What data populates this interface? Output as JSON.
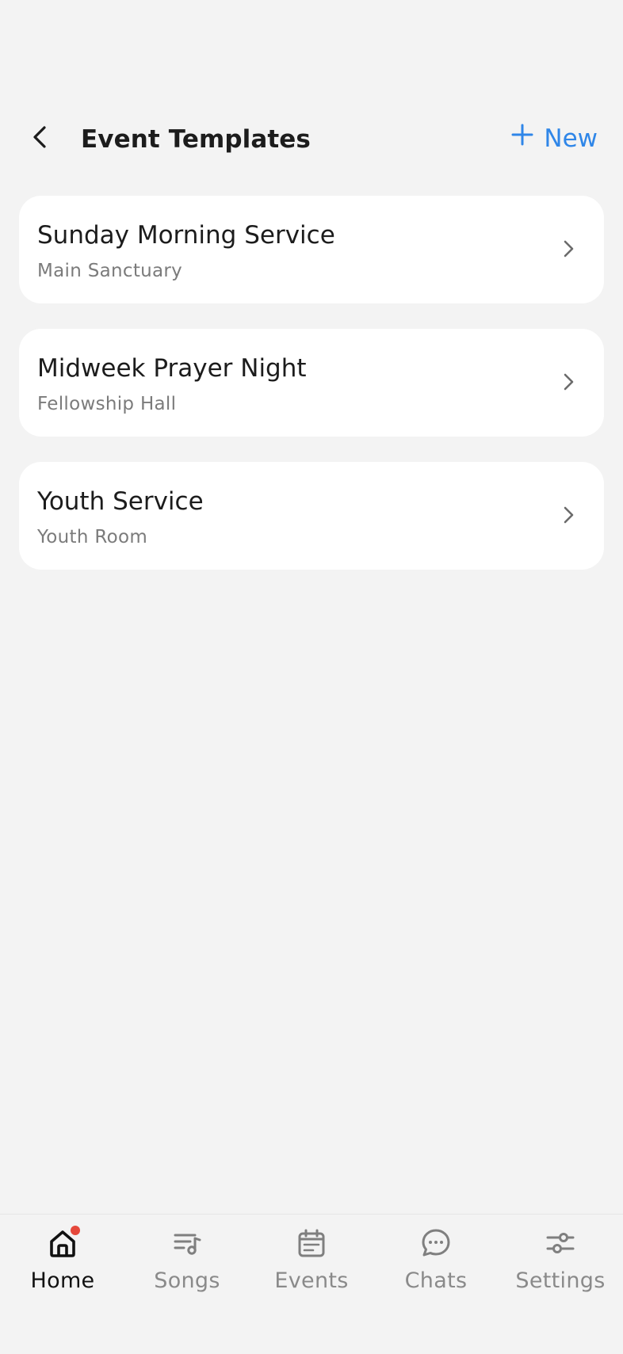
{
  "header": {
    "title": "Event Templates",
    "new_label": "New",
    "accent_color": "#2f86e8"
  },
  "templates": [
    {
      "name": "Sunday Morning Service",
      "location": "Main Sanctuary"
    },
    {
      "name": "Midweek Prayer Night",
      "location": "Fellowship Hall"
    },
    {
      "name": "Youth Service",
      "location": "Youth Room"
    }
  ],
  "nav": {
    "items": [
      {
        "label": "Home",
        "icon": "home-icon",
        "active": true,
        "badge": true
      },
      {
        "label": "Songs",
        "icon": "song-list-icon",
        "active": false
      },
      {
        "label": "Events",
        "icon": "calendar-icon",
        "active": false
      },
      {
        "label": "Chats",
        "icon": "chat-bubble-icon",
        "active": false
      },
      {
        "label": "Settings",
        "icon": "sliders-icon",
        "active": false
      }
    ],
    "badge_color": "#e5483b"
  }
}
